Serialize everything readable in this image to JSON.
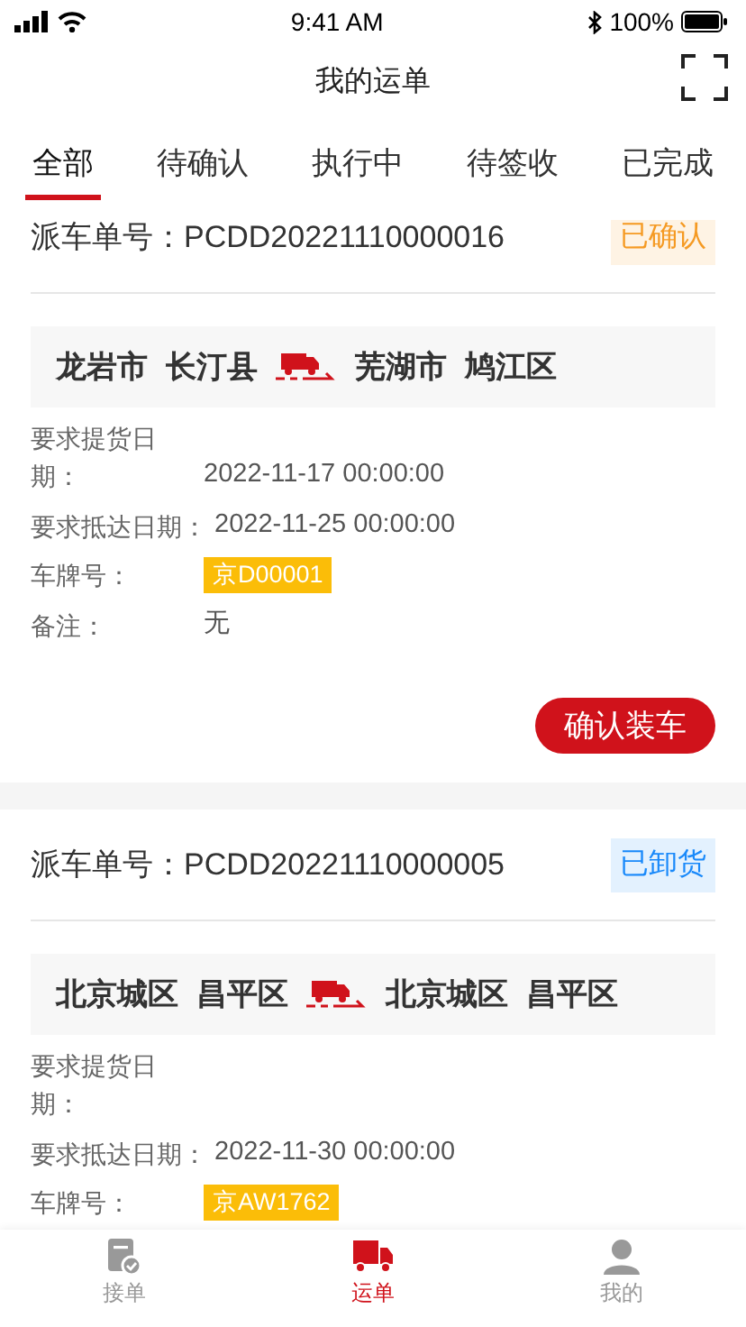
{
  "status_bar": {
    "time": "9:41 AM",
    "battery": "100%"
  },
  "header": {
    "title": "我的运单"
  },
  "tabs": [
    {
      "label": "全部",
      "selected": true
    },
    {
      "label": "待确认",
      "selected": false
    },
    {
      "label": "执行中",
      "selected": false
    },
    {
      "label": "待签收",
      "selected": false
    },
    {
      "label": "已完成",
      "selected": false
    }
  ],
  "orders": [
    {
      "order_label": "派车单号：",
      "order_no": "PCDD20221110000016",
      "status": "已确认",
      "color": "#f59a23",
      "origin": [
        "龙岩市",
        "长汀县"
      ],
      "destination": [
        "芜湖市",
        "鸠江区"
      ],
      "fields": [
        {
          "kind": "wrapped",
          "label": "要求提货日期：",
          "value": "2022-11-17 00:00:00"
        },
        {
          "kind": "inline",
          "label": "要求抵达日期：",
          "value": "2022-11-25 00:00:00"
        },
        {
          "kind": "plate",
          "label": "车牌号：",
          "value": "京D00001"
        },
        {
          "kind": "wrapped",
          "label": "备注：",
          "value": "无"
        }
      ],
      "action": "确认装车"
    },
    {
      "order_label": "派车单号：",
      "order_no": "PCDD20221110000005",
      "status": "已卸货",
      "color": "#1989fa",
      "origin": [
        "北京城区",
        "昌平区"
      ],
      "destination": [
        "北京城区",
        "昌平区"
      ],
      "fields": [
        {
          "kind": "wrapped",
          "label": "要求提货日期："
        },
        {
          "kind": "inline",
          "label": "要求抵达日期：",
          "value": "2022-11-30 00:00:00"
        },
        {
          "kind": "plate",
          "label": "车牌号：",
          "value": "京AW1762"
        }
      ]
    }
  ],
  "bottom_nav": [
    {
      "label": "接单",
      "selected": false
    },
    {
      "label": "运单",
      "selected": true
    },
    {
      "label": "我的",
      "selected": false
    }
  ]
}
